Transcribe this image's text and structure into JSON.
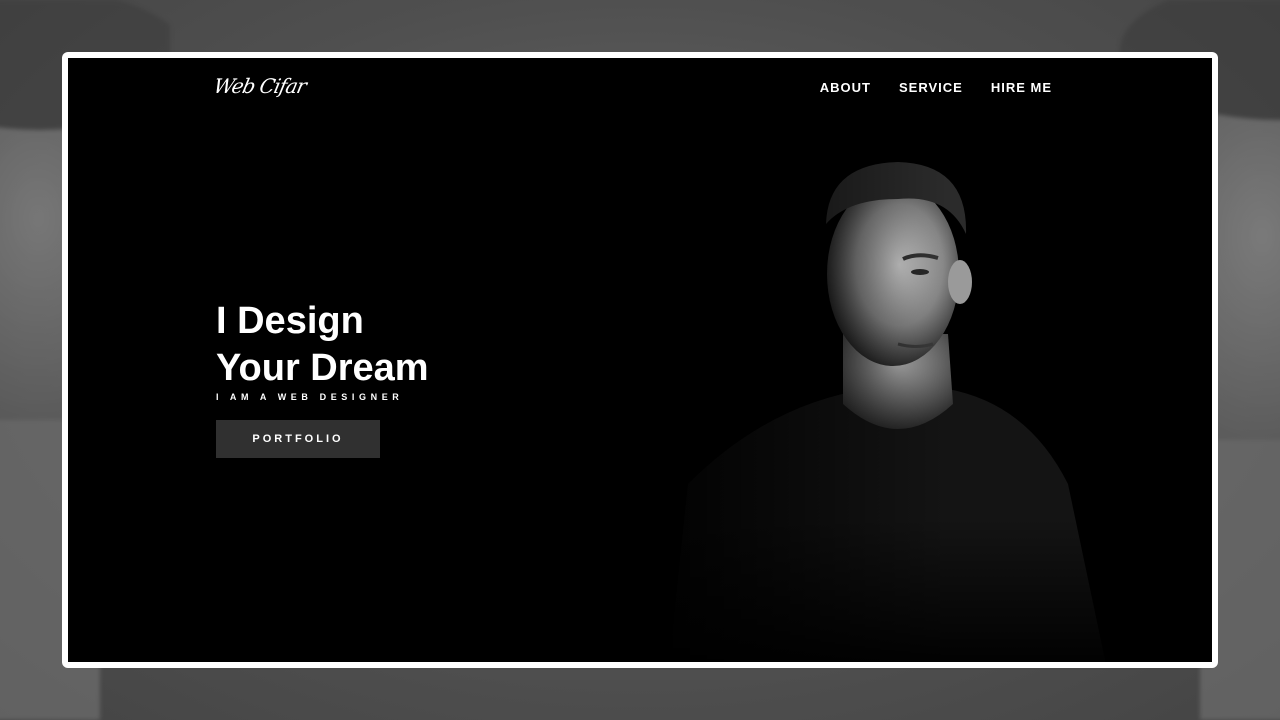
{
  "brand": {
    "logo_text": "Web Cifar"
  },
  "nav": {
    "items": [
      "ABOUT",
      "SERVICE",
      "HIRE ME"
    ]
  },
  "hero": {
    "headline_line1": "I Design",
    "headline_line2": "Your Dream",
    "subtitle": "I AM A WEB DESIGNER",
    "cta_label": "PORTFOLIO"
  },
  "colors": {
    "backdrop": "#575757",
    "frame": "#ffffff",
    "screen_background": "#000000",
    "button_background": "#303030",
    "text": "#ffffff"
  },
  "icons": {
    "logo": "signature-logo",
    "portrait": "portrait-photo"
  }
}
